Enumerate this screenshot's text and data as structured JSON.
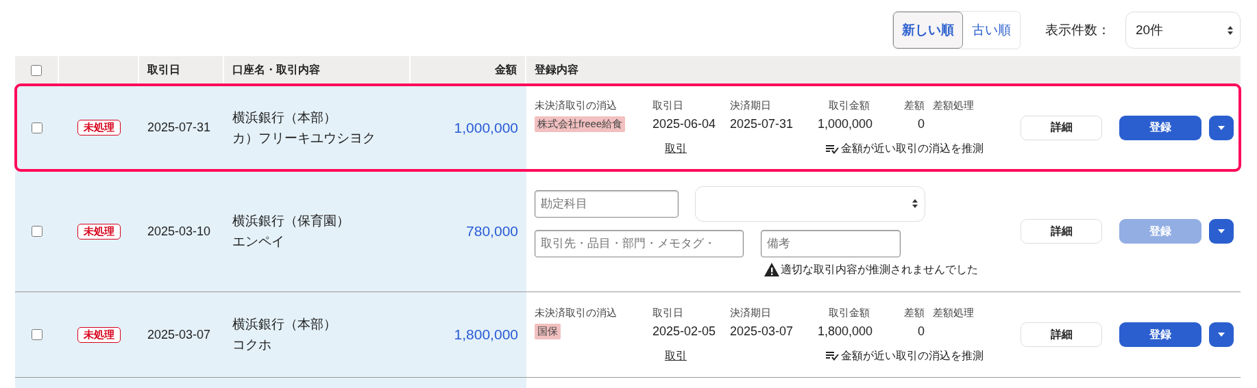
{
  "sort_toggle": [
    {
      "label": "新しい順",
      "selected": true
    },
    {
      "label": "古い順",
      "selected": false
    }
  ],
  "page_size": {
    "label": "表示件数：",
    "value": "20件"
  },
  "table": {
    "select_all_checked": false,
    "columns": [
      "取引日",
      "口座名・取引内容",
      "金額",
      "登録内容"
    ],
    "rows": [
      {
        "kind": "reconcile",
        "checked": false,
        "highlighted": true,
        "status": "未処理",
        "date": "2025-07-31",
        "account": "横浜銀行（本部）",
        "description": "カ）フリーキユウシヨク",
        "amount": "1,000,000",
        "match_label": "未決済取引の消込",
        "tag": "株式会社freee給食",
        "headers": [
          "取引日",
          "決済期日",
          "取引金額",
          "差額",
          "差額処理"
        ],
        "values": [
          "2025-06-04",
          "2025-07-31",
          "1,000,000",
          "0"
        ],
        "link": "取引",
        "hint": "金額が近い取引の消込を推測",
        "detail_button": "詳細",
        "register_button": {
          "label": "登録",
          "disabled": false
        }
      },
      {
        "kind": "manual",
        "checked": false,
        "highlighted": false,
        "status": "未処理",
        "date": "2025-03-10",
        "account": "横浜銀行（保育園）",
        "description": "エンペイ",
        "amount": "780,000",
        "account_placeholder": "勘定科目",
        "partner_placeholder": "取引先・品目・部門・メモタグ・",
        "memo_placeholder": "備考",
        "warning": "適切な取引内容が推測されませんでした",
        "detail_button": "詳細",
        "register_button": {
          "label": "登録",
          "disabled": true
        }
      },
      {
        "kind": "reconcile",
        "checked": false,
        "highlighted": false,
        "status": "未処理",
        "date": "2025-03-07",
        "account": "横浜銀行（本部）",
        "description": "コクホ",
        "amount": "1,800,000",
        "match_label": "未決済取引の消込",
        "tag": "国保",
        "headers": [
          "取引日",
          "決済期日",
          "取引金額",
          "差額",
          "差額処理"
        ],
        "values": [
          "2025-02-05",
          "2025-03-07",
          "1,800,000",
          "0"
        ],
        "link": "取引",
        "hint": "金額が近い取引の消込を推測",
        "detail_button": "詳細",
        "register_button": {
          "label": "登録",
          "disabled": false
        }
      }
    ]
  }
}
